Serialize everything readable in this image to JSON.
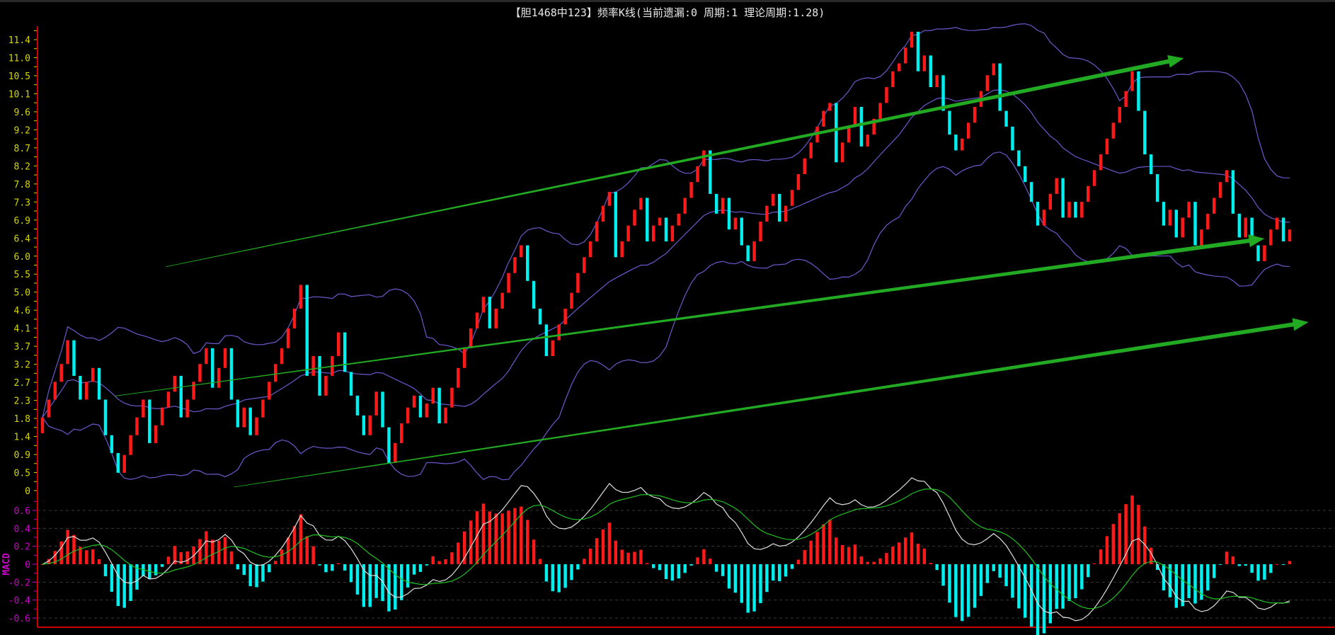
{
  "title": "【胆1468中123】频率K线(当前遗漏:0 周期:1 理论周期:1.28)",
  "colors": {
    "up": "#ff1a1a",
    "down": "#00f0f0",
    "band": "#6a5acd",
    "axis": "#d00000",
    "dif": "#e0e0e0",
    "dea": "#20c020",
    "trend": "#22aa22",
    "price_label": "#d8d800",
    "macd_label": "#d000d0"
  },
  "chart_data": [
    {
      "type": "candlestick",
      "title": "频率K线",
      "ylim": [
        0,
        11.4
      ],
      "yticks": [
        "0",
        "0.5",
        "0.9",
        "1.4",
        "1.8",
        "2.3",
        "2.7",
        "3.2",
        "3.7",
        "4.1",
        "4.6",
        "5.0",
        "5.5",
        "6.0",
        "6.4",
        "6.9",
        "7.3",
        "7.8",
        "8.2",
        "8.7",
        "9.2",
        "9.6",
        "10.1",
        "10.5",
        "11.0",
        "11.4"
      ],
      "closes": [
        1.85,
        2.3,
        2.75,
        3.2,
        3.8,
        2.9,
        2.3,
        2.75,
        3.1,
        2.3,
        1.4,
        0.95,
        0.45,
        0.9,
        1.4,
        1.85,
        2.3,
        1.2,
        1.65,
        2.1,
        2.5,
        2.9,
        1.85,
        2.3,
        2.75,
        3.2,
        3.6,
        2.6,
        3.1,
        3.6,
        2.3,
        1.6,
        2.1,
        1.4,
        1.85,
        2.3,
        2.75,
        3.2,
        3.6,
        4.1,
        4.6,
        5.2,
        2.9,
        3.4,
        2.4,
        2.9,
        3.4,
        4.0,
        3.0,
        2.4,
        1.9,
        1.4,
        1.9,
        2.5,
        1.6,
        0.7,
        1.2,
        1.7,
        2.1,
        2.4,
        1.85,
        2.2,
        2.6,
        1.7,
        2.1,
        2.6,
        3.1,
        3.6,
        4.1,
        4.5,
        4.9,
        4.1,
        4.6,
        5.0,
        5.5,
        5.9,
        6.2,
        5.3,
        4.6,
        4.2,
        3.4,
        3.8,
        4.2,
        4.6,
        5.0,
        5.5,
        5.9,
        6.3,
        6.8,
        7.2,
        7.55,
        5.9,
        6.3,
        6.7,
        7.1,
        7.4,
        6.3,
        6.7,
        6.9,
        6.3,
        6.7,
        7.0,
        7.4,
        7.8,
        8.2,
        8.6,
        7.5,
        7.0,
        7.4,
        6.6,
        6.9,
        6.2,
        5.8,
        6.3,
        6.8,
        7.2,
        7.5,
        6.8,
        7.2,
        7.6,
        8.0,
        8.4,
        8.8,
        9.2,
        9.6,
        9.8,
        8.3,
        8.8,
        9.2,
        9.7,
        8.7,
        9.0,
        9.4,
        9.8,
        10.2,
        10.6,
        10.8,
        11.2,
        11.6,
        10.6,
        11.0,
        10.2,
        10.5,
        9.6,
        9.0,
        8.6,
        8.9,
        9.3,
        9.7,
        10.1,
        10.5,
        10.8,
        9.6,
        9.2,
        8.6,
        8.2,
        7.8,
        7.3,
        6.7,
        7.1,
        7.5,
        7.9,
        6.9,
        7.3,
        6.9,
        7.3,
        7.7,
        8.1,
        8.5,
        8.9,
        9.3,
        9.7,
        10.1,
        10.6,
        9.6,
        8.5,
        8.0,
        7.3,
        6.7,
        7.1,
        6.4,
        6.9,
        7.3,
        6.2,
        6.6,
        7.0,
        7.4,
        7.8,
        8.1,
        7.0,
        6.4,
        6.9,
        6.2,
        5.8,
        6.2,
        6.6,
        6.9,
        6.3,
        6.6
      ],
      "bollinger": {
        "period": 20,
        "k": 2
      },
      "trendlines": [
        {
          "from": [
            19.6,
            5.66
          ],
          "to": [
            181.2,
            10.93
          ]
        },
        {
          "from": [
            11.5,
            2.39
          ],
          "to": [
            194,
            6.37
          ]
        },
        {
          "from": [
            30.4,
            0.09
          ],
          "to": [
            201,
            4.26
          ]
        }
      ]
    },
    {
      "type": "macd",
      "label": "MACD",
      "ylim": [
        -0.6,
        0.6
      ],
      "yticks": [
        "-0.6",
        "-0.4",
        "-0.2",
        "0",
        "0.2",
        "0.4",
        "0.6"
      ],
      "params": {
        "fast": 12,
        "slow": 26,
        "signal": 9
      }
    }
  ]
}
